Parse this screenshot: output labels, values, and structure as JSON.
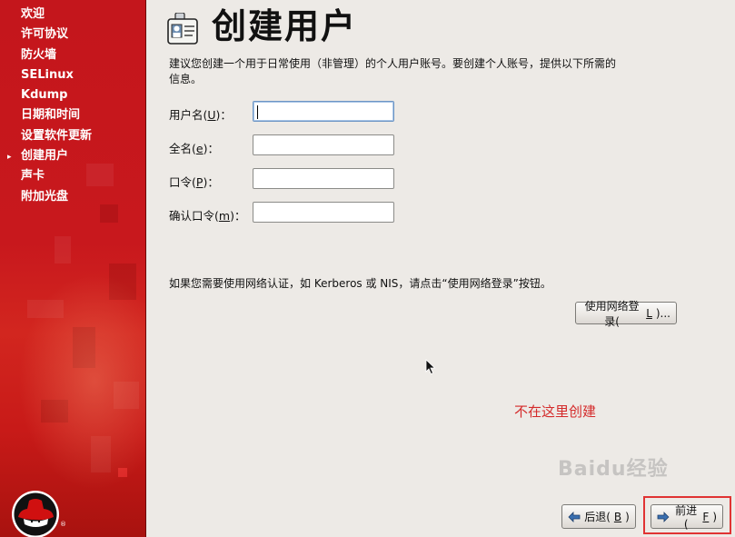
{
  "sidebar": {
    "items": [
      {
        "label": "欢迎"
      },
      {
        "label": "许可协议"
      },
      {
        "label": "防火墙"
      },
      {
        "label": "SELinux"
      },
      {
        "label": "Kdump"
      },
      {
        "label": "日期和时间"
      },
      {
        "label": "设置软件更新"
      },
      {
        "label": "创建用户",
        "current": true
      },
      {
        "label": "声卡"
      },
      {
        "label": "附加光盘"
      }
    ],
    "current_indicator": "▸",
    "brand_color": "#c4161c",
    "logo_icon": "redhat-shadowman-logo-icon"
  },
  "header": {
    "title": "创建用户",
    "icon": "id-card-icon"
  },
  "description": "建议您创建一个用于日常使用（非管理）的个人用户账号。要创建个人账号，提供以下所需的信息。",
  "form": {
    "username": {
      "label_pre": "用户名(",
      "mnemonic": "U",
      "label_post": ")：",
      "value": ""
    },
    "fullname": {
      "label_pre": "全名(",
      "mnemonic": "e",
      "label_post": ")：",
      "value": ""
    },
    "password": {
      "label_pre": "口令(",
      "mnemonic": "P",
      "label_post": ")：",
      "value": ""
    },
    "confirm": {
      "label_pre": "确认口令(",
      "mnemonic": "m",
      "label_post": ")：",
      "value": ""
    }
  },
  "network": {
    "note": "如果您需要使用网络认证，如 Kerberos 或 NIS，请点击“使用网络登录”按钮。",
    "button_label": "使用网络登录(",
    "button_mnemonic": "L",
    "button_suffix": ")..."
  },
  "annotation": {
    "text": "不在这里创建",
    "color": "#d42a2a"
  },
  "watermark": "Baidu经验",
  "buttons": {
    "back": {
      "label": "后退(",
      "mnemonic": "B",
      "suffix": ")",
      "icon": "arrow-left-icon"
    },
    "forward": {
      "label": "前进(",
      "mnemonic": "F",
      "suffix": ")",
      "icon": "arrow-right-icon"
    }
  }
}
